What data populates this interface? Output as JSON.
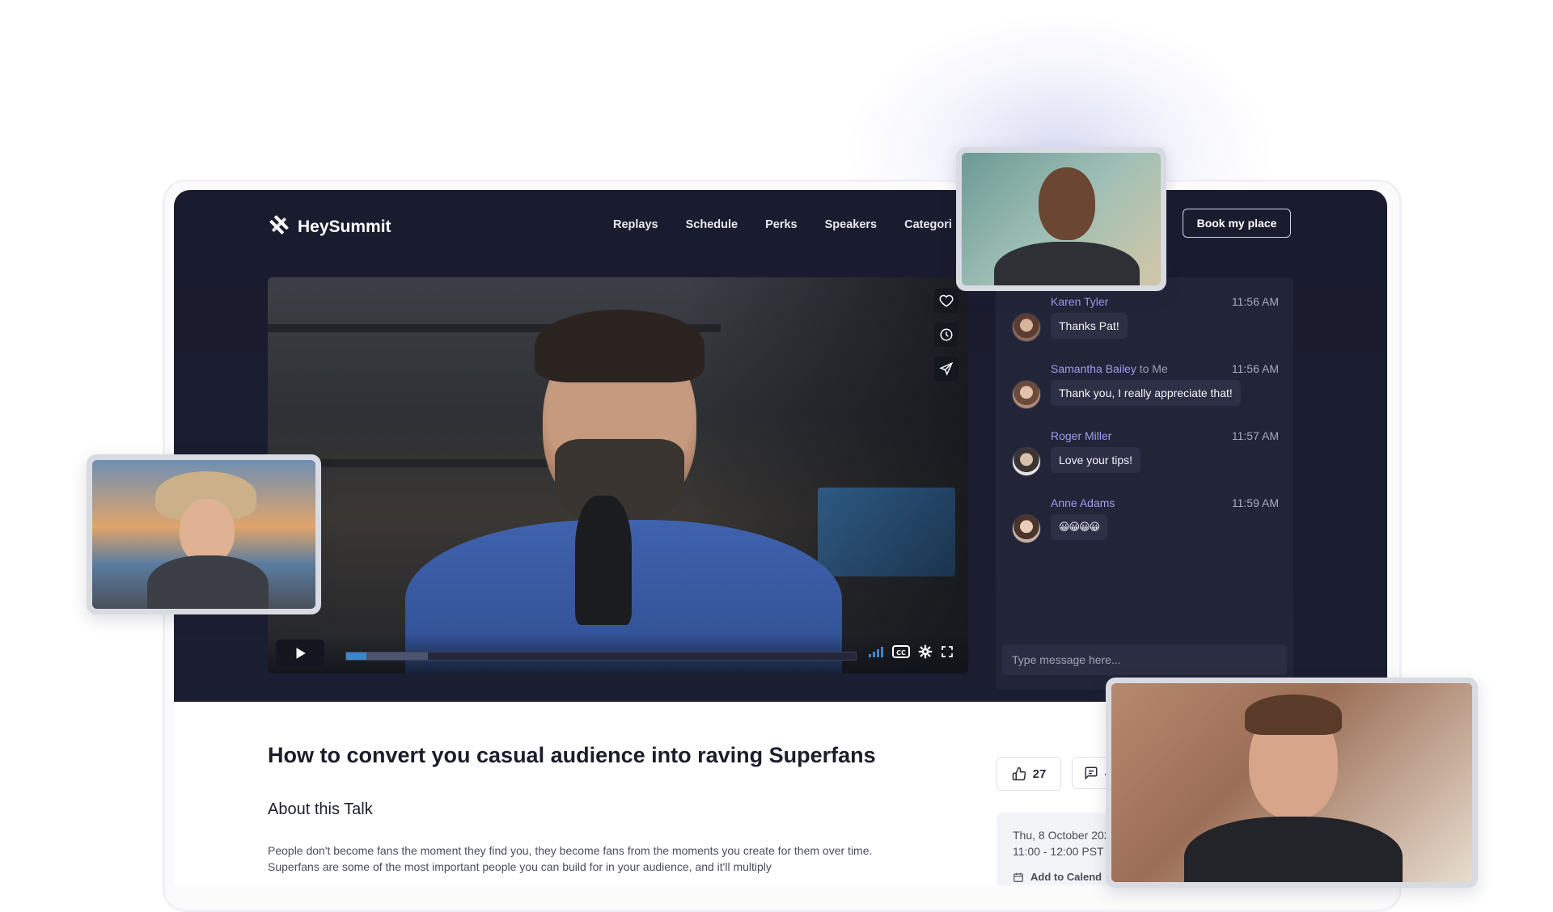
{
  "brand": {
    "name": "HeySummit"
  },
  "nav": {
    "items": [
      "Replays",
      "Schedule",
      "Perks",
      "Speakers",
      "Categori"
    ]
  },
  "header": {
    "cta_label": "Book my place"
  },
  "video": {
    "progress_fraction": 0.04,
    "buffer_fraction": 0.16,
    "side_icons": [
      "heart-icon",
      "clock-icon",
      "send-icon"
    ],
    "control_icons": [
      "play-icon",
      "signal-icon",
      "closed-captions-icon",
      "settings-icon",
      "fullscreen-icon"
    ]
  },
  "chat": {
    "messages": [
      {
        "author": "Karen Tyler",
        "recipient": "",
        "time": "11:56 AM",
        "text": "Thanks Pat!"
      },
      {
        "author": "Samantha Bailey",
        "recipient": "to Me",
        "time": "11:56 AM",
        "text": "Thank you, I really appreciate that!"
      },
      {
        "author": "Roger Miller",
        "recipient": "",
        "time": "11:57 AM",
        "text": "Love your tips!"
      },
      {
        "author": "Anne Adams",
        "recipient": "",
        "time": "11:59 AM",
        "text": "😀😀😀😀"
      }
    ],
    "input_placeholder": "Type message here..."
  },
  "talk": {
    "title": "How to convert you casual audience into raving Superfans",
    "about_heading": "About this Talk",
    "description": "People don't become fans the moment they find you, they become fans from the moments you create for them over time. Superfans are some of the most important people you can build for in your audience, and it'll multiply",
    "likes": "27",
    "comments": "4",
    "date": "Thu, 8 October 202",
    "time_range": "11:00 - 12:00 PST",
    "calendar_label": "Add to Calend"
  },
  "colors": {
    "hero_bg": "#191b2e",
    "chat_name": "#9f9df0",
    "progress": "#3a86c9",
    "signal": "#3a86c9"
  }
}
